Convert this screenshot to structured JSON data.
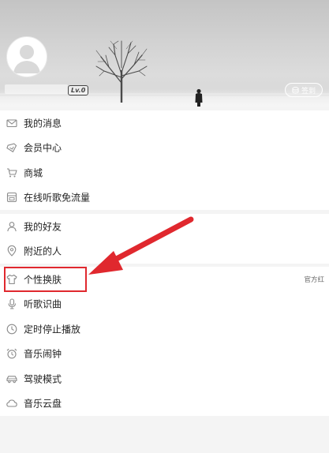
{
  "profile": {
    "level": "Lv.0",
    "signin_label": "签到"
  },
  "menu": {
    "group1": [
      {
        "label": "我的消息",
        "icon": "mail-icon"
      },
      {
        "label": "会员中心",
        "icon": "member-diamond-icon"
      },
      {
        "label": "商城",
        "icon": "shopping-cart-icon"
      },
      {
        "label": "在线听歌免流量",
        "icon": "data-card-icon"
      }
    ],
    "group2": [
      {
        "label": "我的好友",
        "icon": "friend-icon"
      },
      {
        "label": "附近的人",
        "icon": "location-pin-icon"
      }
    ],
    "group3": [
      {
        "label": "个性换肤",
        "icon": "tshirt-icon",
        "value": "官方红"
      },
      {
        "label": "听歌识曲",
        "icon": "microphone-icon"
      },
      {
        "label": "定时停止播放",
        "icon": "clock-icon"
      },
      {
        "label": "音乐闹钟",
        "icon": "alarm-clock-icon"
      },
      {
        "label": "驾驶模式",
        "icon": "car-icon"
      },
      {
        "label": "音乐云盘",
        "icon": "cloud-icon"
      }
    ]
  },
  "colors": {
    "annotation_red": "#e0282e",
    "icon_gray": "#8a8a8a"
  }
}
